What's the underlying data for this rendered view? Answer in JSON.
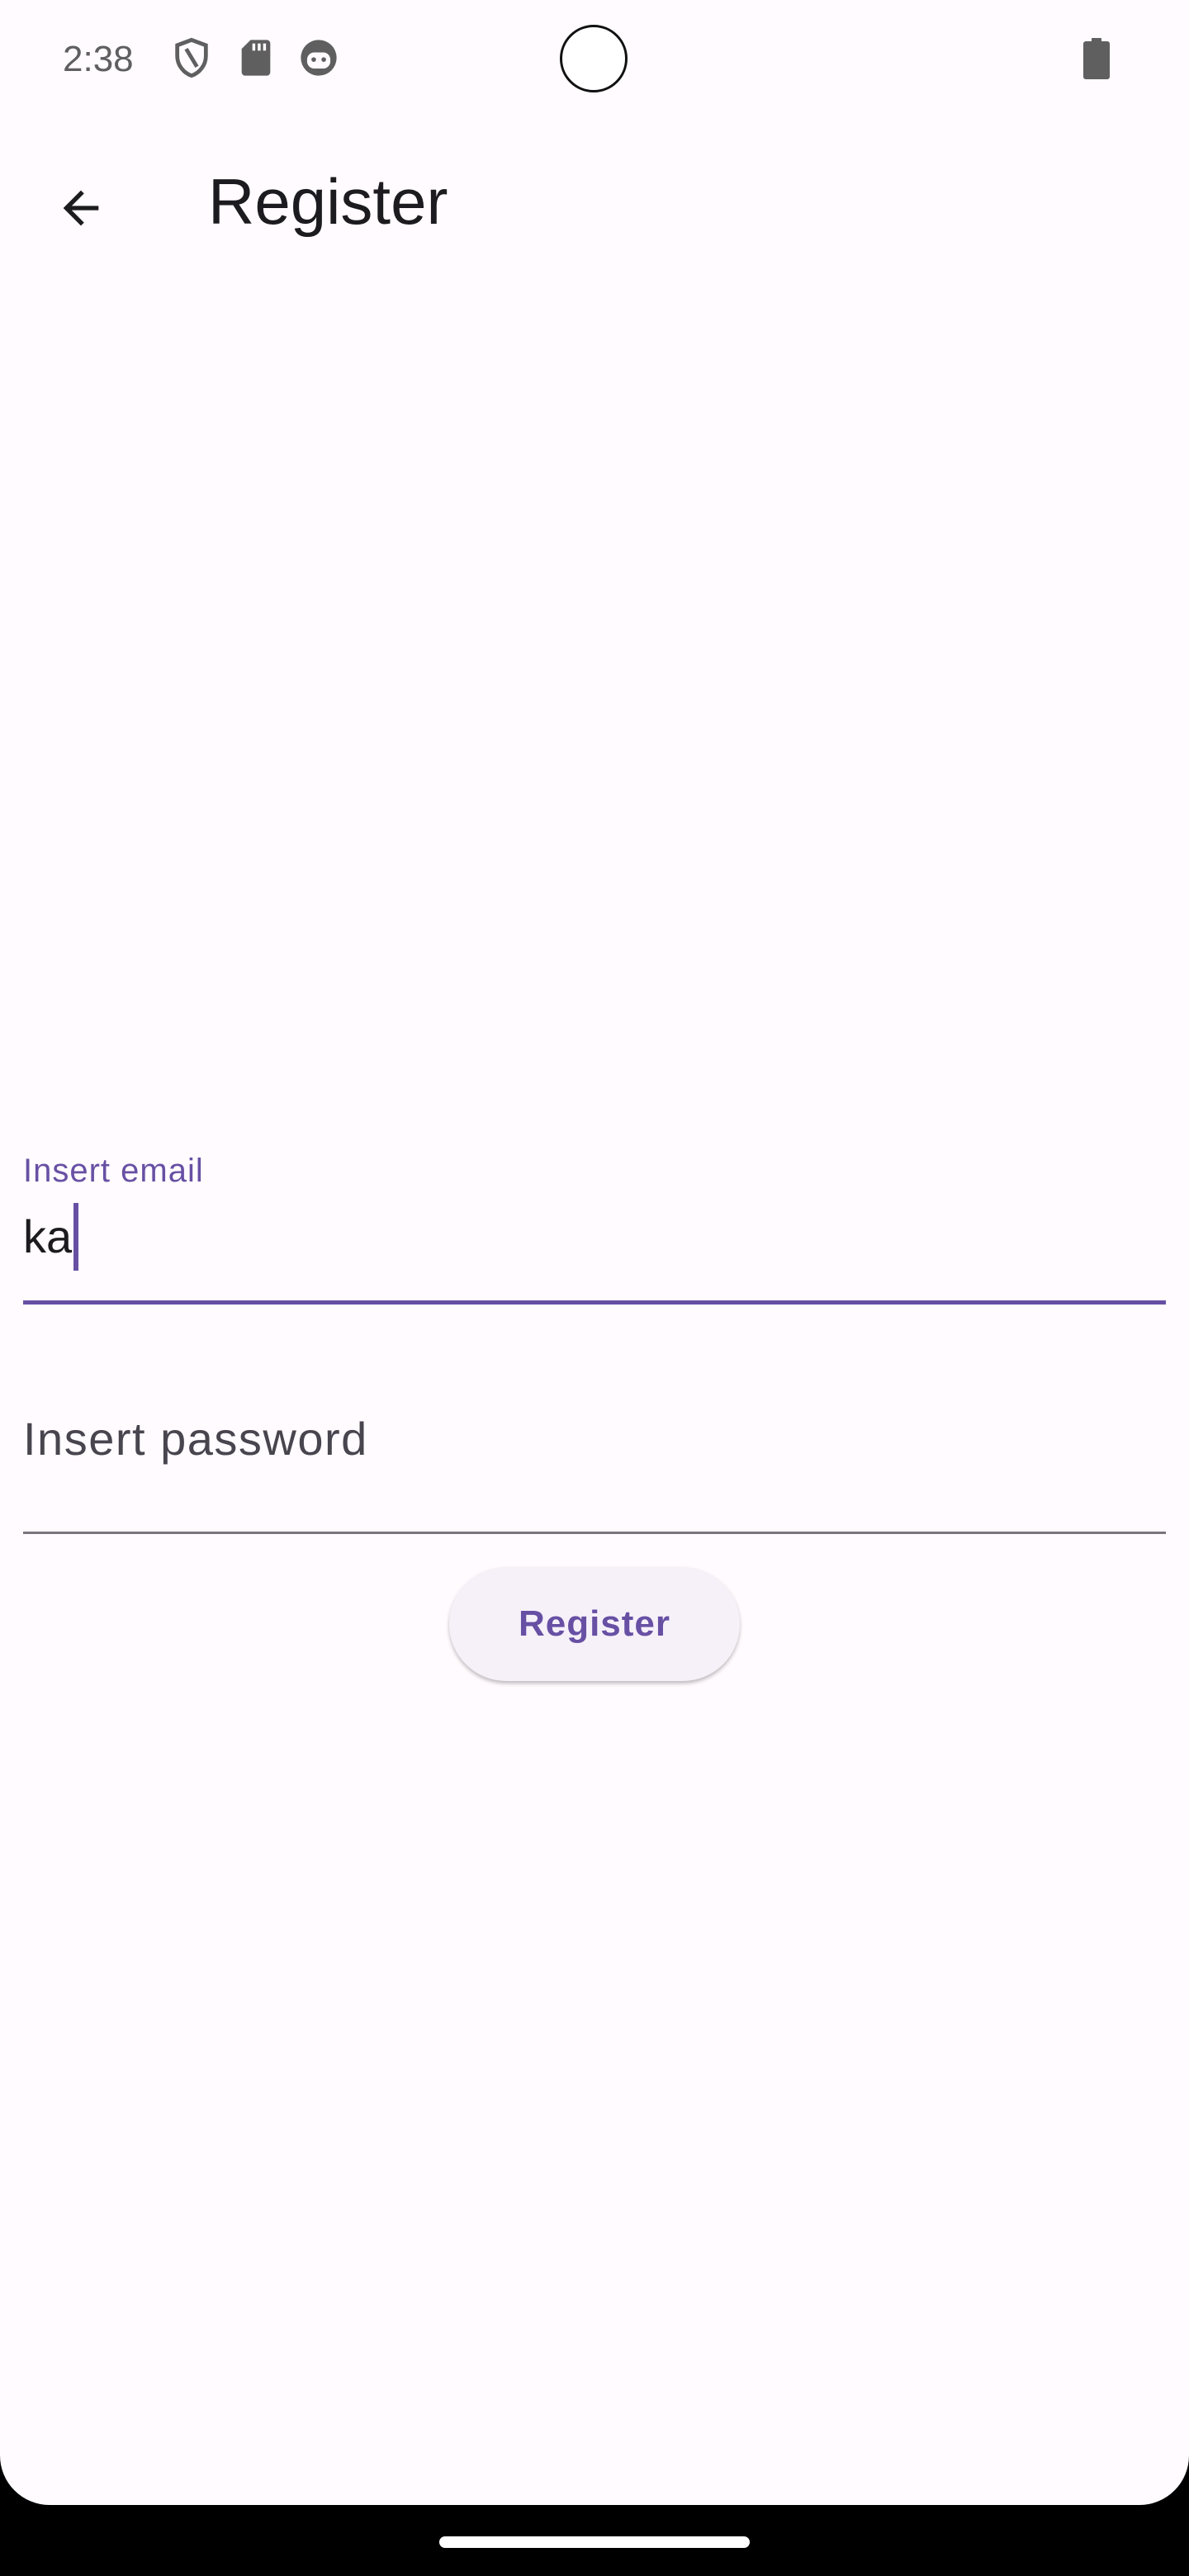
{
  "status_bar": {
    "time": "2:38",
    "icons": [
      "shield-icon",
      "sd-card-icon",
      "android-face-icon"
    ],
    "battery_icon": "battery-icon"
  },
  "app_bar": {
    "back_icon": "arrow-back-icon",
    "title": "Register"
  },
  "form": {
    "email": {
      "label": "Insert email",
      "value": "ka"
    },
    "password": {
      "label": "Insert password",
      "value": ""
    },
    "submit_label": "Register"
  },
  "colors": {
    "accent": "#6750a4",
    "background": "#fffbfe",
    "button_background": "#f6f1f9",
    "text_primary": "#1c1b1f",
    "text_secondary": "#49454f",
    "divider": "#79747e"
  }
}
